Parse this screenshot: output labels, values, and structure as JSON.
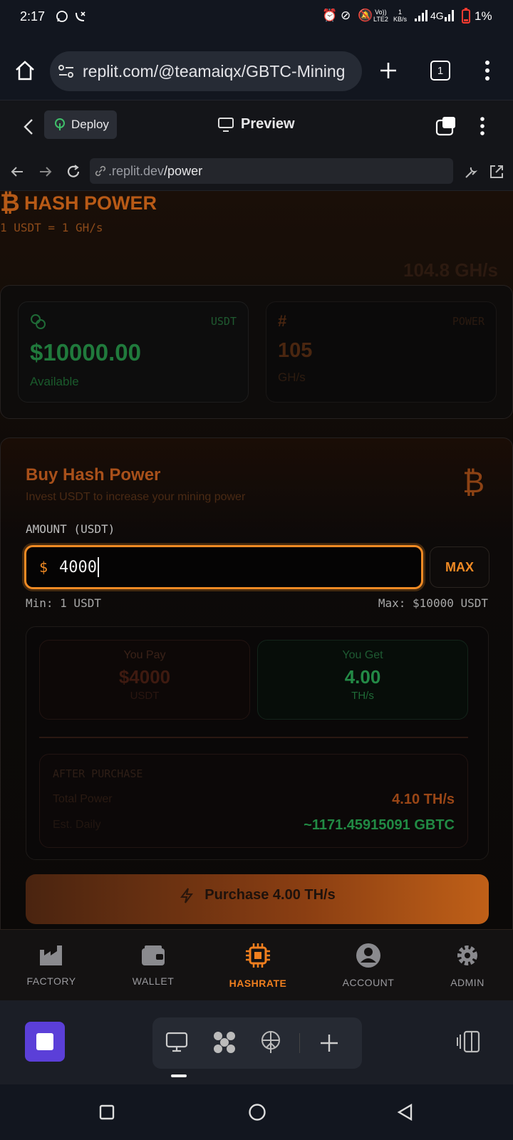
{
  "status": {
    "time": "2:17",
    "battery": "1%",
    "lte": "LTE2",
    "kbs": "1",
    "kbs_unit": "KB/s",
    "net": "4G"
  },
  "browser": {
    "url": "replit.com/@teamaiqx/GBTC-Mining",
    "tab_count": "1"
  },
  "replit": {
    "deploy_label": "Deploy",
    "preview_label": "Preview"
  },
  "nav": {
    "domain": ".replit.dev",
    "path": "/power"
  },
  "app": {
    "brand": "HASH POWER",
    "rate": "1 USDT = 1 GH/s",
    "top_power": "104.8 GH/s",
    "usdt_card": {
      "tag": "USDT",
      "value": "$10000.00",
      "sub": "Available"
    },
    "power_card": {
      "tag": "POWER",
      "value": "105",
      "sub": "GH/s"
    },
    "buy": {
      "title": "Buy Hash Power",
      "subtitle": "Invest USDT to increase your mining power",
      "amount_label": "AMOUNT (USDT)",
      "currency": "$",
      "amount_value": "4000",
      "max_button": "MAX",
      "min_hint": "Min: 1 USDT",
      "max_hint": "Max: $10000 USDT"
    },
    "summary": {
      "pay_label": "You Pay",
      "pay_value": "$4000",
      "pay_unit": "USDT",
      "get_label": "You Get",
      "get_value": "4.00",
      "get_unit": "TH/s",
      "after_label": "AFTER PURCHASE",
      "total_label": "Total Power",
      "total_value": "4.10 TH/s",
      "est_label": "Est. Daily",
      "est_value": "~1171.45915091 GBTC"
    },
    "purchase_button": "Purchase 4.00 TH/s"
  },
  "bottom_nav": [
    {
      "label": "FACTORY",
      "icon": "factory-icon"
    },
    {
      "label": "WALLET",
      "icon": "wallet-icon"
    },
    {
      "label": "HASHRATE",
      "icon": "cpu-icon",
      "active": true
    },
    {
      "label": "ACCOUNT",
      "icon": "account-icon"
    },
    {
      "label": "ADMIN",
      "icon": "gear-icon"
    }
  ],
  "colors": {
    "accent": "#f08a24",
    "green": "#2fbf5a",
    "active_nav": "#f07f1e",
    "stop_button": "#5b3fd8"
  }
}
